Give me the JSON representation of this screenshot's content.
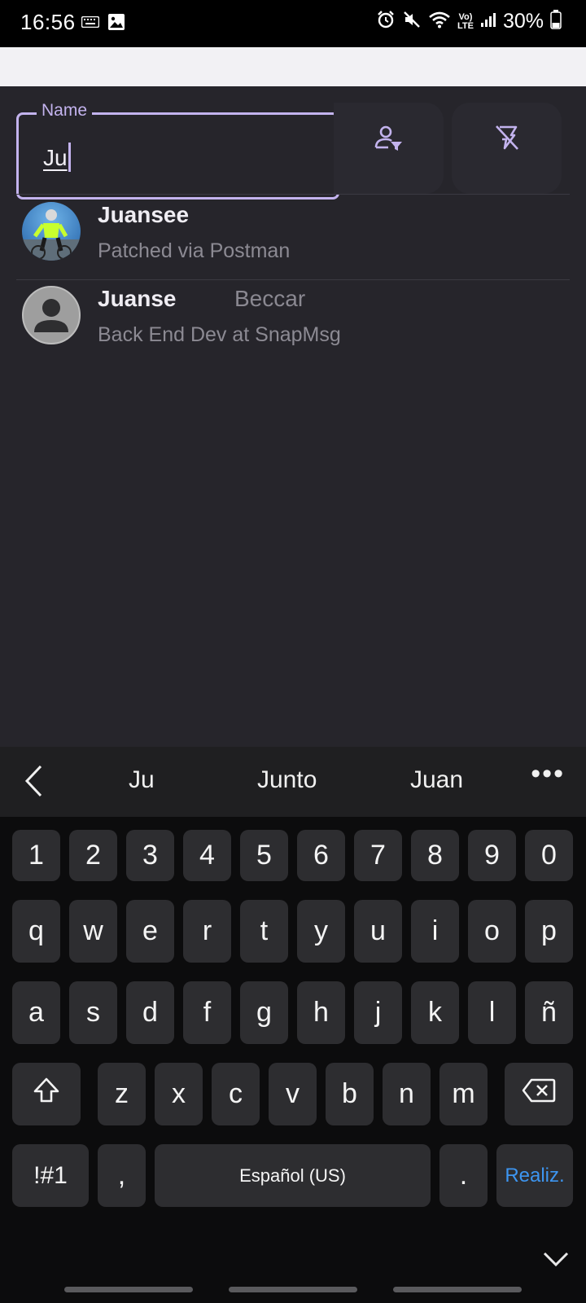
{
  "status_bar": {
    "time": "16:56",
    "battery_percent": "30%",
    "left_icons": [
      "keyboard-icon",
      "image-icon"
    ],
    "right_icons": [
      "alarm-icon",
      "mute-icon",
      "wifi-icon",
      "volte-icon",
      "signal-icon",
      "battery-icon"
    ],
    "volte_label_top": "Vo)",
    "volte_label_bottom": "LTE"
  },
  "search": {
    "label": "Name",
    "value": "Ju",
    "filter_buttons": [
      "user-filter-icon",
      "flash-off-icon"
    ],
    "accent_color": "#c3b3ee"
  },
  "results": [
    {
      "name": "Juansee",
      "location": "",
      "bio": "Patched via Postman",
      "avatar": "photo"
    },
    {
      "name": "Juanse",
      "location": "Beccar",
      "bio": "Back End Dev at SnapMsg",
      "avatar": "default-user"
    }
  ],
  "keyboard": {
    "suggestions": [
      "Ju",
      "Junto",
      "Juan"
    ],
    "rows": {
      "numbers": [
        "1",
        "2",
        "3",
        "4",
        "5",
        "6",
        "7",
        "8",
        "9",
        "0"
      ],
      "row1": [
        "q",
        "w",
        "e",
        "r",
        "t",
        "y",
        "u",
        "i",
        "o",
        "p"
      ],
      "row2": [
        "a",
        "s",
        "d",
        "f",
        "g",
        "h",
        "j",
        "k",
        "l",
        "ñ"
      ],
      "row3": [
        "z",
        "x",
        "c",
        "v",
        "b",
        "n",
        "m"
      ]
    },
    "symbols_label": "!#1",
    "comma_label": ",",
    "space_label": "Español (US)",
    "period_label": ".",
    "done_label": "Realiz.",
    "done_color": "#3d95f0"
  }
}
